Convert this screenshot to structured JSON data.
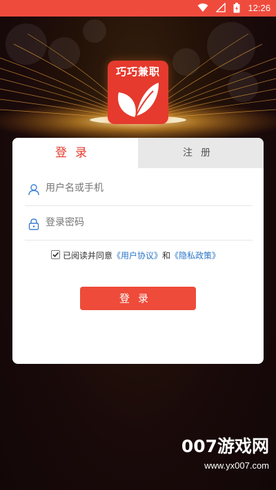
{
  "status_bar": {
    "time": "12:26",
    "icons": [
      "wifi-icon",
      "signal-icon",
      "battery-icon"
    ]
  },
  "logo": {
    "text": "巧巧兼职",
    "color": "#e53a2d",
    "icon": "leaf-icon"
  },
  "tabs": [
    {
      "label": "登录",
      "active": true
    },
    {
      "label": "注册",
      "active": false
    }
  ],
  "form": {
    "username_placeholder": "用户名或手机",
    "password_placeholder": "登录密码",
    "username_icon": "user-icon",
    "password_icon": "lock-icon"
  },
  "agreement": {
    "checked": true,
    "prefix": "已阅读并同意",
    "user_agreement": "《用户协议》",
    "and": "和",
    "privacy_policy": "《隐私政策》"
  },
  "login_button": "登录",
  "watermark": {
    "line1": "007游戏网",
    "line2": "www.yx007.com"
  },
  "colors": {
    "accent": "#ee4b3a",
    "link": "#2a76c8",
    "status_bar": "#ef4b3d"
  }
}
